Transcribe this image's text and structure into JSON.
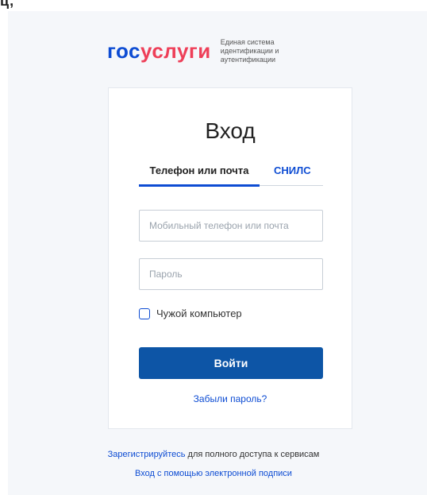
{
  "top_crop": {
    "text": "ц,"
  },
  "header": {
    "logo_part1": "гос",
    "logo_part2": "услуги",
    "tagline": "Единая система идентификации и аутентификации",
    "colors": {
      "logo_blue": "#0d4cd3",
      "logo_red": "#ee3f58"
    }
  },
  "login_card": {
    "title": "Вход",
    "tabs": [
      {
        "label": "Телефон или почта",
        "active": true
      },
      {
        "label": "СНИЛС",
        "active": false
      }
    ],
    "login_input": {
      "placeholder": "Мобильный телефон или почта",
      "value": ""
    },
    "password_input": {
      "placeholder": "Пароль",
      "value": ""
    },
    "checkbox": {
      "label": "Чужой компьютер",
      "checked": false
    },
    "submit_label": "Войти",
    "forgot_label": "Забыли пароль?",
    "colors": {
      "accent": "#0d4cd3",
      "button": "#0d55a6"
    }
  },
  "footer": {
    "register_link": "Зарегистрируйтесь",
    "register_text": " для полного доступа к сервисам",
    "esign_link": "Вход с помощью электронной подписи"
  },
  "icons": [
    "checkbox-icon"
  ]
}
